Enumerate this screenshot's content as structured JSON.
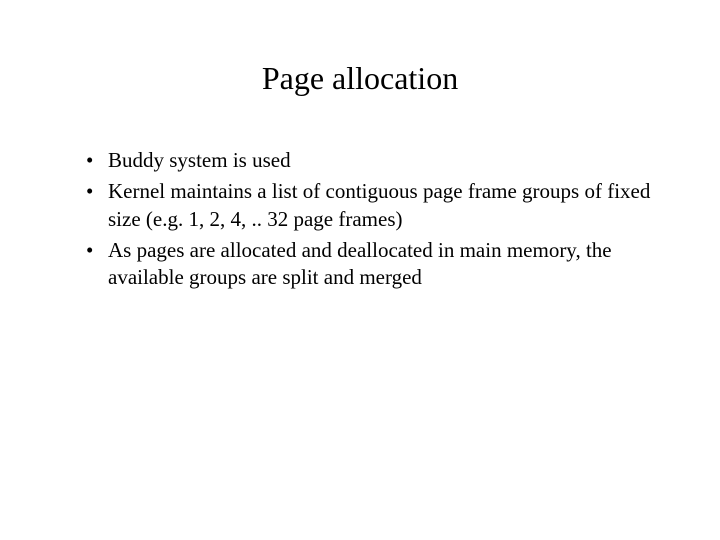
{
  "slide": {
    "title": "Page allocation",
    "bullets": [
      "Buddy system is used",
      "Kernel maintains a list of contiguous page frame groups of fixed size (e.g. 1, 2, 4, .. 32 page frames)",
      "As pages are allocated and deallocated in main memory, the available groups are split and merged"
    ]
  }
}
